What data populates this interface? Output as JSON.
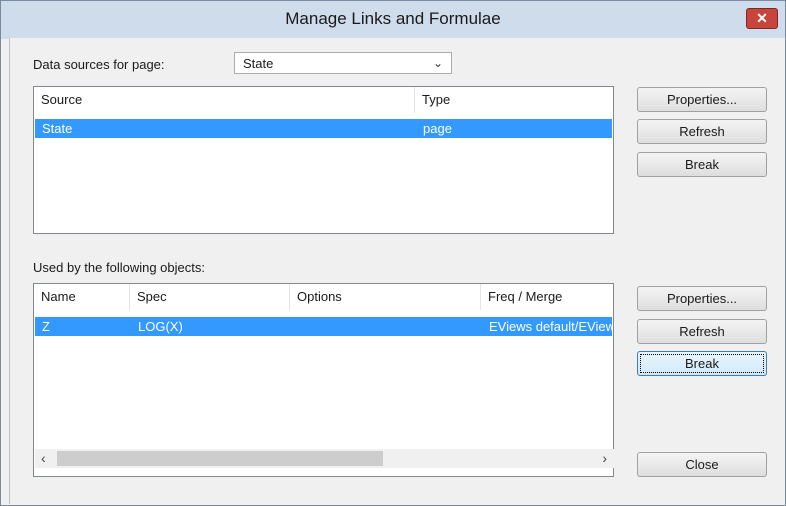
{
  "window": {
    "title": "Manage Links and Formulae",
    "close_label": "x"
  },
  "data_sources": {
    "label": "Data sources for page:",
    "selected": "State",
    "columns": [
      "Source",
      "Type"
    ],
    "rows": [
      {
        "source": "State",
        "type": "page"
      }
    ]
  },
  "used_by": {
    "label": "Used by the following objects:",
    "columns": [
      "Name",
      "Spec",
      "Options",
      "Freq / Merge"
    ],
    "rows": [
      {
        "name": "Z",
        "spec": "LOG(X)",
        "options": "",
        "freq_merge": "EViews default/EView"
      }
    ]
  },
  "buttons": {
    "properties": "Properties...",
    "refresh": "Refresh",
    "break": "Break",
    "close": "Close"
  },
  "icons": {
    "close": "close-icon",
    "dropdown": "chevron-down-icon",
    "scroll_left": "chevron-left-icon",
    "scroll_right": "chevron-right-icon"
  }
}
